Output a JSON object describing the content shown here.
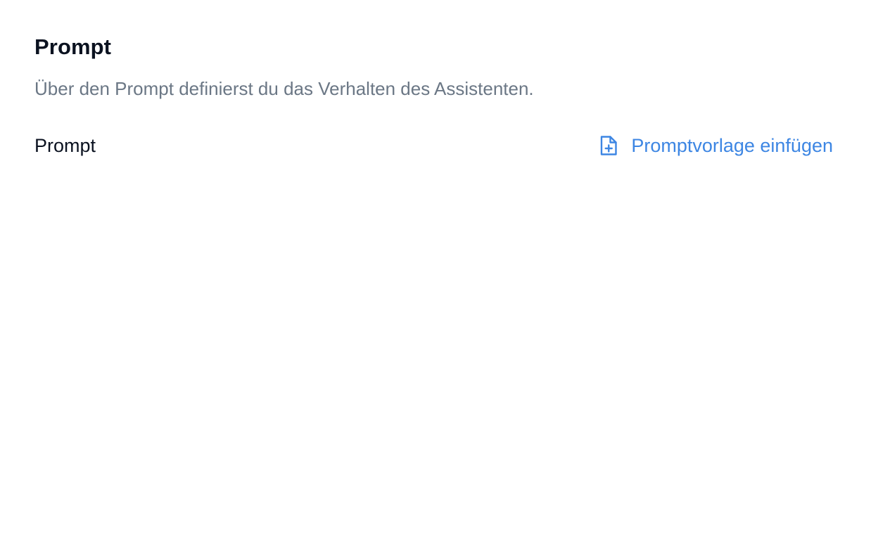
{
  "section": {
    "title": "Prompt",
    "description": "Über den Prompt definierst du das Verhalten des Assistenten."
  },
  "prompt_field": {
    "label": "Prompt",
    "insert_template_label": "Promptvorlage einfügen",
    "insert_template_icon": "file-plus-icon"
  },
  "colors": {
    "accent": "#3d86e3",
    "heading": "#0b1220",
    "muted": "#6b7785"
  }
}
